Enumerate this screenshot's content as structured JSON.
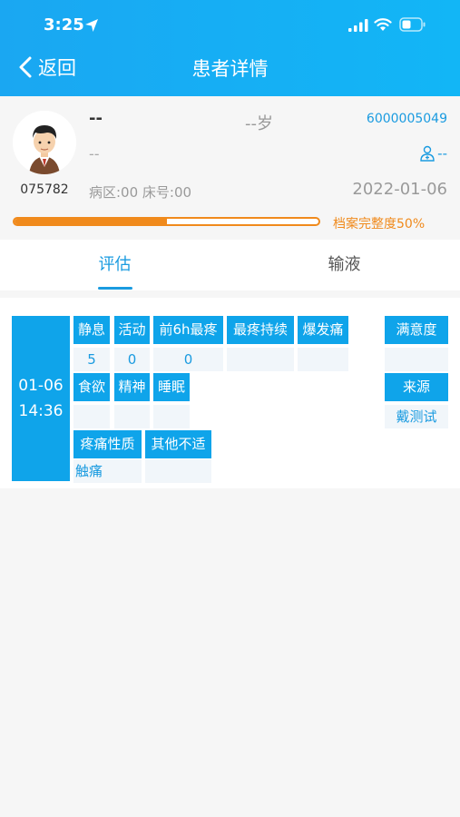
{
  "status": {
    "time": "3:25"
  },
  "nav": {
    "back_label": "返回",
    "title": "患者详情"
  },
  "patient": {
    "name": "--",
    "age": "--岁",
    "number": "6000005049",
    "sub": "--",
    "doctor": "--",
    "id": "075782",
    "ward_bed": "病区:00 床号:00",
    "date": "2022-01-06",
    "completeness_label": "档案完整度50%",
    "completeness_fraction": 0.5
  },
  "tabs": [
    {
      "label": "评估",
      "active": true
    },
    {
      "label": "输液",
      "active": false
    }
  ],
  "record": {
    "date": "01-06",
    "time": "14:36",
    "labels": {
      "rest": "静息",
      "activity": "活动",
      "worst_6h": "前6h最疼",
      "worst_duration": "最疼持续",
      "breakthrough": "爆发痛",
      "satisfaction": "满意度",
      "appetite": "食欲",
      "spirit": "精神",
      "sleep": "睡眠",
      "source": "来源",
      "pain_nature": "疼痛性质",
      "other_discomfort": "其他不适"
    },
    "values": {
      "rest": "5",
      "activity": "0",
      "worst_6h": "0",
      "worst_duration": "",
      "breakthrough": "",
      "satisfaction": "",
      "appetite": "",
      "spirit": "",
      "sleep": "",
      "source": "戴测试",
      "pain_nature": "触痛",
      "other_discomfort": ""
    }
  },
  "colors": {
    "primary": "#0fa4ea",
    "accent": "#f08a1c"
  },
  "icons": [
    "location-arrow-icon",
    "signal-icon",
    "wifi-icon",
    "battery-icon",
    "chevron-left-icon",
    "avatar",
    "doctor-icon"
  ]
}
